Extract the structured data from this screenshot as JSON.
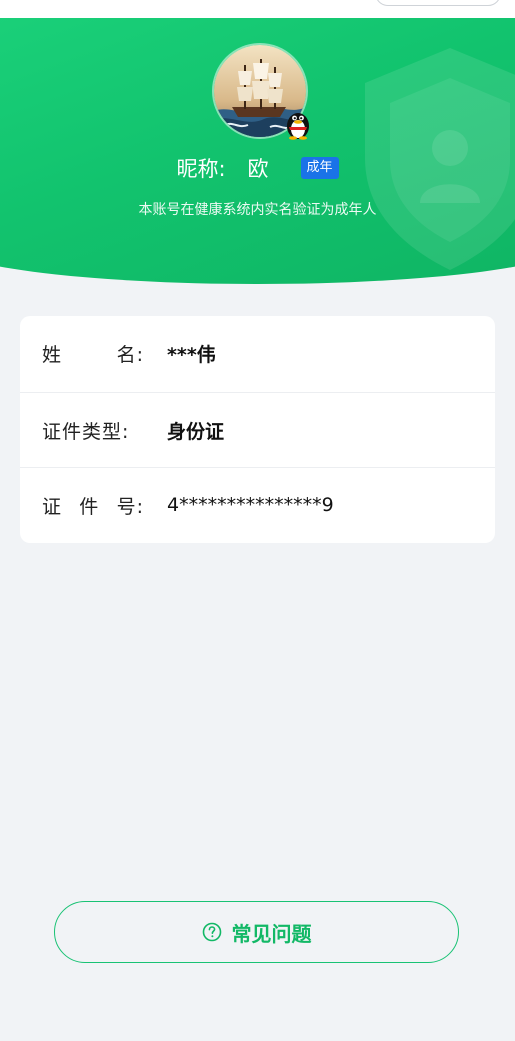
{
  "profile": {
    "nickname_label": "昵称:",
    "nickname_value": "欧",
    "adult_badge": "成年",
    "verify_text": "本账号在健康系统内实名验证为成年人"
  },
  "info": {
    "rows": [
      {
        "label_chars": [
          "姓",
          "名:"
        ],
        "value": "***伟"
      },
      {
        "label": "证件类型:",
        "value": "身份证"
      },
      {
        "label_chars": [
          "证",
          "件",
          "号:"
        ],
        "value": "4***************9"
      }
    ]
  },
  "faq": {
    "label": "常见问题",
    "icon": "question-circle-icon"
  },
  "colors": {
    "brand_green": "#12c36e",
    "badge_blue": "#1a73e8",
    "page_bg": "#f1f3f6"
  }
}
